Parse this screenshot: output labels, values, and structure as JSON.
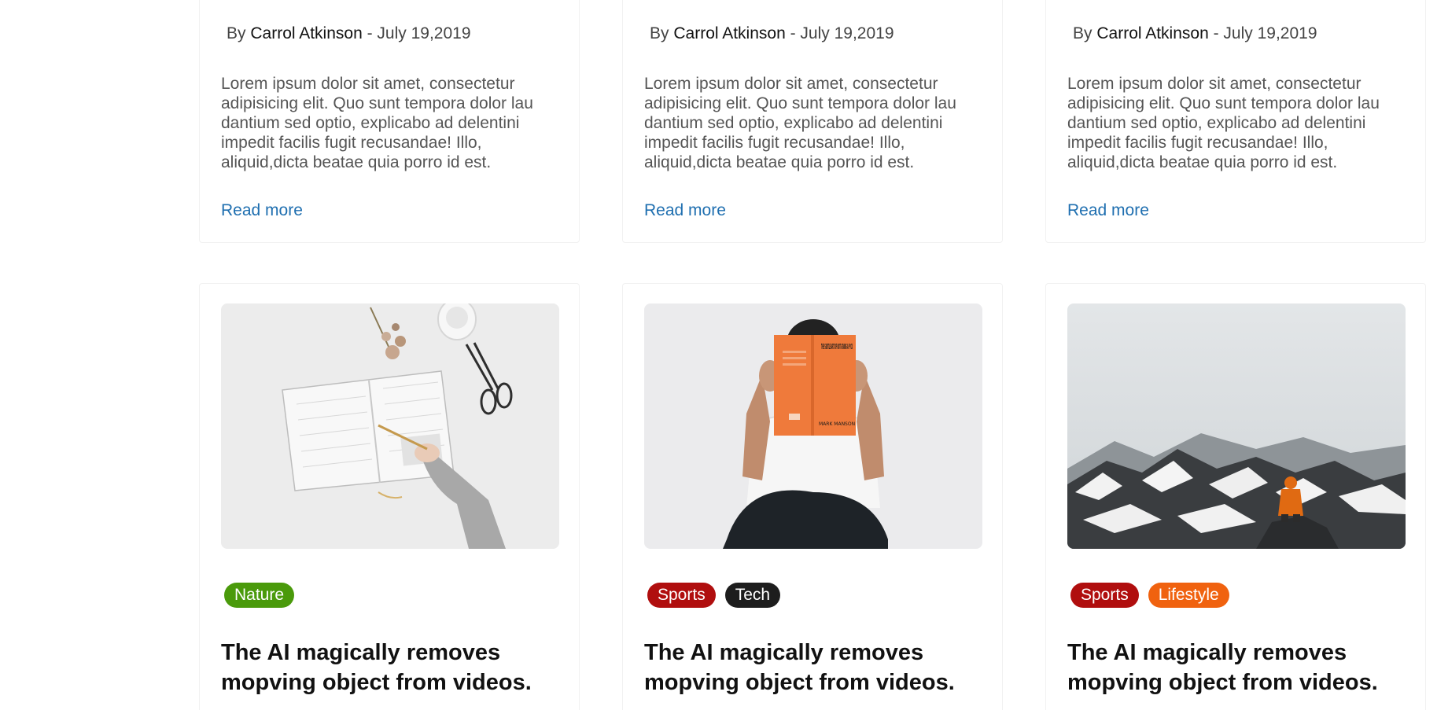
{
  "posts_top": [
    {
      "by": "By",
      "author": "Carrol Atkinson",
      "date": "- July 19,2019",
      "excerpt": "Lorem ipsum dolor sit amet, consectetur adipisicing elit. Quo sunt tempora dolor lau dantium sed optio, explicabo ad delentini impedit facilis fugit recusandae! Illo, aliquid,dicta beatae quia porro id est.",
      "read_more": "Read more"
    },
    {
      "by": "By",
      "author": "Carrol Atkinson",
      "date": "- July 19,2019",
      "excerpt": "Lorem ipsum dolor sit amet, consectetur adipisicing elit. Quo sunt tempora dolor lau dantium sed optio, explicabo ad delentini impedit facilis fugit recusandae! Illo, aliquid,dicta beatae quia porro id est.",
      "read_more": "Read more"
    },
    {
      "by": "By",
      "author": "Carrol Atkinson",
      "date": "- July 19,2019",
      "excerpt": "Lorem ipsum dolor sit amet, consectetur adipisicing elit. Quo sunt tempora dolor lau dantium sed optio, explicabo ad delentini impedit facilis fugit recusandae! Illo, aliquid,dicta beatae quia porro id est.",
      "read_more": "Read more"
    }
  ],
  "posts_bottom": [
    {
      "image": "notebook-writing-photo",
      "tags": [
        {
          "label": "Nature",
          "color": "#4a9a0b"
        }
      ],
      "title": "The AI magically removes mopving object from videos."
    },
    {
      "image": "man-reading-book-photo",
      "book_title": "THE SUBTLE ART OF NOT GIVING A F*CK",
      "book_author": "MARK MANSON",
      "tags": [
        {
          "label": "Sports",
          "color": "#b00e0e"
        },
        {
          "label": "Tech",
          "color": "#1d1d1d"
        }
      ],
      "title": "The AI magically removes mopving object from videos."
    },
    {
      "image": "snowy-mountain-hiker-photo",
      "tags": [
        {
          "label": "Sports",
          "color": "#b00e0e"
        },
        {
          "label": "Lifestyle",
          "color": "#f0620f"
        }
      ],
      "title": "The AI magically removes mopving object from videos."
    }
  ],
  "colors": {
    "link": "#1f6fb0",
    "heading": "#111111",
    "body_text": "#555555"
  }
}
